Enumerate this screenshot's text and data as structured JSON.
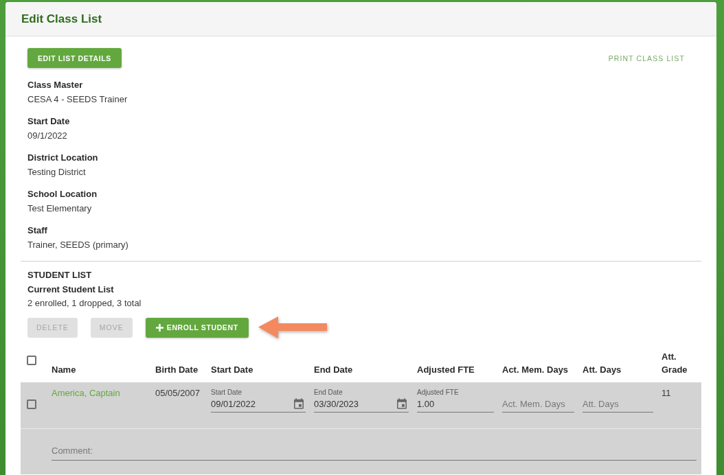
{
  "header": {
    "title": "Edit Class List"
  },
  "toolbar": {
    "edit_button": "EDIT LIST DETAILS",
    "print_link": "PRINT CLASS LIST"
  },
  "details": [
    {
      "label": "Class Master",
      "value": "CESA 4 - SEEDS Trainer"
    },
    {
      "label": "Start Date",
      "value": "09/1/2022"
    },
    {
      "label": "District Location",
      "value": "Testing District"
    },
    {
      "label": "School Location",
      "value": "Test Elementary"
    },
    {
      "label": "Staff",
      "value": "Trainer, SEEDS (primary)"
    }
  ],
  "student_list": {
    "heading": "STUDENT LIST",
    "subheading": "Current Student List",
    "summary": "2 enrolled, 1 dropped, 3 total",
    "buttons": [
      {
        "label": "DELETE",
        "kind": "plain",
        "disabled": true
      },
      {
        "label": "MOVE",
        "kind": "plain",
        "disabled": true
      },
      {
        "label": "ENROLL STUDENT",
        "kind": "add",
        "disabled": false
      }
    ]
  },
  "table": {
    "select_all": {
      "checked": false
    },
    "columns": [
      "Name",
      "Birth Date",
      "Start Date",
      "End Date",
      "Adjusted FTE",
      "Act. Mem. Days",
      "Att. Days",
      "Att. Grade"
    ],
    "rows": [
      {
        "checked": false,
        "cells": [
          {
            "kind": "link",
            "text": "America, Captain"
          },
          {
            "kind": "text",
            "text": "05/05/2007"
          },
          {
            "kind": "date",
            "label": "Start Date",
            "value": "09/01/2022"
          },
          {
            "kind": "date",
            "label": "End Date",
            "value": "03/30/2023"
          },
          {
            "kind": "input",
            "label": "Adjusted FTE",
            "value": "1.00"
          },
          {
            "kind": "input",
            "placeholder": "Act. Mem. Days"
          },
          {
            "kind": "input",
            "placeholder": "Att. Days"
          },
          {
            "kind": "text",
            "text": "11"
          }
        ],
        "comment": {
          "placeholder": "Comment:"
        }
      }
    ]
  }
}
